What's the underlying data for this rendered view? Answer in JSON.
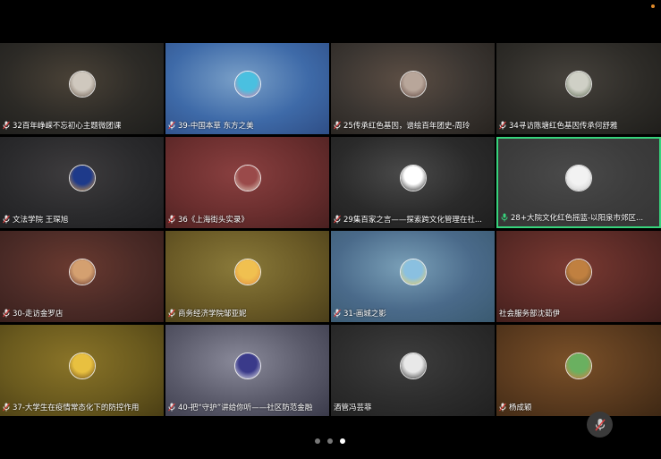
{
  "colors": {
    "active_border": "#37d37c",
    "status_dot": "#e08a2a",
    "pager_inactive": "#777777",
    "pager_active": "#ffffff"
  },
  "participants": [
    {
      "name": "32百年峥嵘不忘初心主题微团课",
      "bg": [
        "#2c2a26",
        "#4a4237",
        "#1e1e1c"
      ],
      "avatar": [
        "#cfc8be",
        "#6a5a4c"
      ],
      "mic": "muted"
    },
    {
      "name": "39-中国本草 东方之美",
      "bg": [
        "#3e6aa8",
        "#7aa0c8",
        "#2f4e86"
      ],
      "avatar": [
        "#4ac0e0",
        "#e07aa8"
      ],
      "mic": "muted"
    },
    {
      "name": "25传承红色基因，谱绘百年团史-周玲",
      "bg": [
        "#3a3531",
        "#5c4e44",
        "#27231f"
      ],
      "avatar": [
        "#b8a69a",
        "#5a4038"
      ],
      "mic": "muted"
    },
    {
      "name": "34寻访陈塘红色基因传承何舒雅",
      "bg": [
        "#2e2c28",
        "#46423c",
        "#1f1e1b"
      ],
      "avatar": [
        "#cfd0c6",
        "#5c6a52"
      ],
      "mic": "muted"
    },
    {
      "name": "文法学院 王琛旭",
      "bg": [
        "#2a2a2c",
        "#3e3c3e",
        "#1e1e20"
      ],
      "avatar": [
        "#1e3a8a",
        "#e0a040"
      ],
      "mic": "muted"
    },
    {
      "name": "36《上海街头实录》",
      "bg": [
        "#6a2e2e",
        "#8a4040",
        "#4a2020"
      ],
      "avatar": [
        "#9a4a4a",
        "#e0d0c0"
      ],
      "mic": "muted"
    },
    {
      "name": "29集百家之言——探索跨文化管理在社...",
      "bg": [
        "#2a2a2a",
        "#4a4a4a",
        "#1e1e1e"
      ],
      "avatar": [
        "#ffffff",
        "#1a1a1a"
      ],
      "mic": "muted"
    },
    {
      "name": "28+大院文化红色摇篮-以阳泉市郊区...",
      "bg": [
        "#3c3c3c",
        "#4a4a4a",
        "#353535"
      ],
      "avatar": [
        "#f2f2f2",
        "#c8c8c8"
      ],
      "mic": "active",
      "active": true
    },
    {
      "name": "30-走访金罗店",
      "bg": [
        "#4a2a26",
        "#6a3a30",
        "#351d1a"
      ],
      "avatar": [
        "#d4a070",
        "#6a3a30"
      ],
      "mic": "muted"
    },
    {
      "name": "商务经济学院邹亚妮",
      "bg": [
        "#6a5a26",
        "#8a7a3a",
        "#4a3e1a"
      ],
      "avatar": [
        "#f0c050",
        "#e08a40"
      ],
      "mic": "muted"
    },
    {
      "name": "31-画城之影",
      "bg": [
        "#4a6a8a",
        "#7aa0b8",
        "#3a5a70"
      ],
      "avatar": [
        "#8ac0e0",
        "#f0d060"
      ],
      "mic": "muted"
    },
    {
      "name": "社会服务部沈茹伊",
      "bg": [
        "#5a2a26",
        "#7a3a32",
        "#3e1d1a"
      ],
      "avatar": [
        "#c08040",
        "#6a4a2a"
      ],
      "mic": "none"
    },
    {
      "name": "37-大学生在疫情常态化下的防控作用",
      "bg": [
        "#6a5a1e",
        "#8a7428",
        "#4a3e14"
      ],
      "avatar": [
        "#e8c040",
        "#6a4a1a"
      ],
      "mic": "muted"
    },
    {
      "name": "40-把“守护”讲给你听——社区防范金融",
      "bg": [
        "#5a5a6a",
        "#8a8a9a",
        "#3a3a4a"
      ],
      "avatar": [
        "#3a3a8a",
        "#f0f0f0"
      ],
      "mic": "muted"
    },
    {
      "name": "酒管冯芸菲",
      "bg": [
        "#2c2c2c",
        "#3e3e3e",
        "#202020"
      ],
      "avatar": [
        "#e8e8e8",
        "#2a2a2a"
      ],
      "mic": "none"
    },
    {
      "name": "杨成颖",
      "bg": [
        "#5a3a1e",
        "#7a5028",
        "#3e2814"
      ],
      "avatar": [
        "#6ab060",
        "#e07a40"
      ],
      "mic": "muted"
    }
  ],
  "pager": {
    "pages": 3,
    "current": 3
  }
}
